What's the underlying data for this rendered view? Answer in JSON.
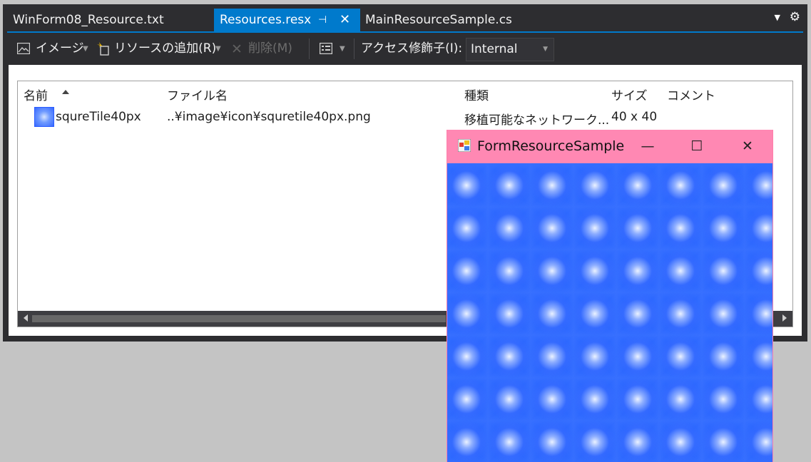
{
  "tabs": [
    {
      "label": "WinForm08_Resource.txt"
    },
    {
      "label": "Resources.resx",
      "pin_glyph": "⊣",
      "close_glyph": "✕"
    },
    {
      "label": "MainResourceSample.cs"
    }
  ],
  "tabstrip": {
    "dropdown_icon": "chevron-down-icon",
    "settings_icon": "gear-icon"
  },
  "toolbar": {
    "image_label": "イメージ",
    "add_resource_label": "リソースの追加(R)",
    "delete_label": "削除(M)",
    "access_modifier_label": "アクセス修飾子(I):",
    "access_modifier_value": "Internal"
  },
  "grid": {
    "headers": {
      "name": "名前",
      "filename": "ファイル名",
      "type": "種類",
      "size": "サイズ",
      "comment": "コメント"
    },
    "rows": [
      {
        "name": "squreTile40px",
        "filename": "..¥image¥icon¥squretile40px.png",
        "type": "移植可能なネットワーク...",
        "size": "40 x 40",
        "comment": ""
      }
    ]
  },
  "form": {
    "title": "FormResourceSample",
    "minimize_glyph": "—",
    "maximize_glyph": "☐",
    "close_glyph": "✕"
  },
  "colors": {
    "accent": "#007acc",
    "ide_background": "#2d2d30",
    "form_titlebar": "#ff88b3",
    "tile_blue": "#1556ff"
  }
}
